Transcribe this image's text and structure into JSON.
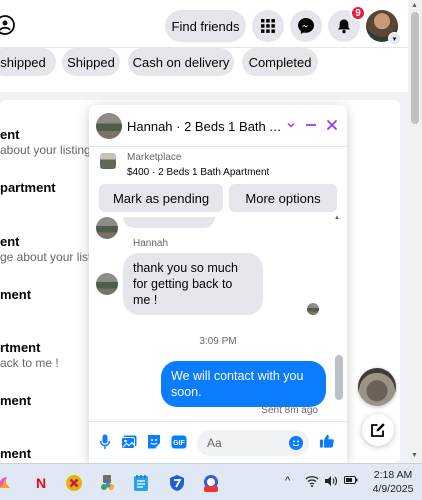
{
  "topnav": {
    "find_friends": "Find friends",
    "notif_count": "9"
  },
  "chips": [
    "shipped",
    "Shipped",
    "Cash on delivery",
    "Completed"
  ],
  "listings": [
    {
      "title": "ent",
      "subtitle": "about your listing"
    },
    {
      "title": "partment",
      "subtitle": ""
    },
    {
      "title": "ent",
      "subtitle": "ge about your listi"
    },
    {
      "title": "ment",
      "subtitle": ""
    },
    {
      "title": "rtment",
      "subtitle": "ack to me !"
    },
    {
      "title": "ment",
      "subtitle": ""
    },
    {
      "title": "ment",
      "subtitle": ""
    }
  ],
  "chat": {
    "title": "Hannah · 2 Beds 1 Bath Ap...",
    "marketplace_label": "Marketplace",
    "item": "$400 · 2 Beds 1 Bath Apartment",
    "mark_pending": "Mark as pending",
    "more_options": "More options",
    "sender": "Hannah",
    "incoming": "thank you so much for getting back to me !",
    "time": "3:09 PM",
    "outgoing": "We will contact with you soon.",
    "sent_meta": "Sent 8m ago",
    "input_placeholder": "Aa"
  },
  "taskbar": {
    "time": "2:18 AM",
    "date": "4/9/2025"
  },
  "colors": {
    "messenger_accent": "#a033ff",
    "outgoing_bubble": "#0a7cff",
    "badge": "#e41e3f"
  }
}
